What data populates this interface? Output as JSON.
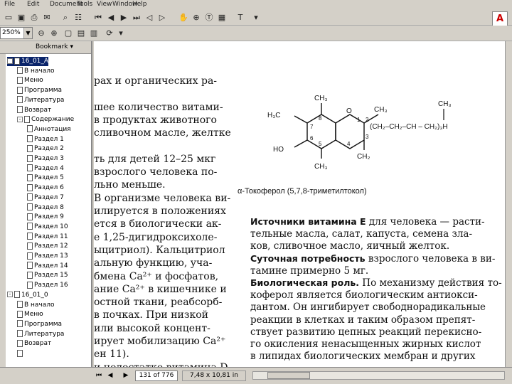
{
  "menu": {
    "items": [
      "File",
      "Edit",
      "Document",
      "Tools",
      "View",
      "Window",
      "Help"
    ]
  },
  "toolbar": {
    "zoom_value": "250%",
    "adobe_logo": "A"
  },
  "nav": {
    "bookmark_label": "Bookmark",
    "tree": [
      {
        "label": "16_01_A",
        "level": 0,
        "expander": "-",
        "selected": true
      },
      {
        "label": "В начало",
        "level": 1
      },
      {
        "label": "Меню",
        "level": 1
      },
      {
        "label": "Программа",
        "level": 1
      },
      {
        "label": "Литература",
        "level": 1
      },
      {
        "label": "Возврат",
        "level": 1
      },
      {
        "label": "Содержание",
        "level": 1,
        "expander": "-"
      },
      {
        "label": "Аннотация",
        "level": 2
      },
      {
        "label": "Раздел 1",
        "level": 2
      },
      {
        "label": "Раздел 2",
        "level": 2
      },
      {
        "label": "Раздел 3",
        "level": 2
      },
      {
        "label": "Раздел 4",
        "level": 2
      },
      {
        "label": "Раздел 5",
        "level": 2
      },
      {
        "label": "Раздел 6",
        "level": 2
      },
      {
        "label": "Раздел 7",
        "level": 2
      },
      {
        "label": "Раздел 8",
        "level": 2
      },
      {
        "label": "Раздел 9",
        "level": 2
      },
      {
        "label": "Раздел 10",
        "level": 2
      },
      {
        "label": "Раздел 11",
        "level": 2
      },
      {
        "label": "Раздел 12",
        "level": 2
      },
      {
        "label": "Раздел 13",
        "level": 2
      },
      {
        "label": "Раздел 14",
        "level": 2
      },
      {
        "label": "Раздел 15",
        "level": 2
      },
      {
        "label": "Раздел 16",
        "level": 2
      },
      {
        "label": "16_01_0",
        "level": 0,
        "expander": "-"
      },
      {
        "label": "В начало",
        "level": 1
      },
      {
        "label": "Меню",
        "level": 1
      },
      {
        "label": "Программа",
        "level": 1
      },
      {
        "label": "Литература",
        "level": 1
      },
      {
        "label": "Возврат",
        "level": 1
      },
      {
        "label": "",
        "level": 1
      }
    ]
  },
  "document": {
    "left_column": [
      "рах и органических ра-",
      "",
      "шее количество витами-",
      "в продуктах животного",
      "сливочном масле, желтке",
      "",
      "ть для детей 12–25 мкг",
      "взрослого человека по-",
      "льно меньше.",
      "В организме человека ви-",
      "илируется в положениях",
      "ется в биологически ак-",
      "е 1,25-дигидроксихоле-",
      "ыцитриол). Кальцитриол",
      "альную функцию, уча-",
      "бмена Ca²⁺ и фосфатов,",
      "ание Ca²⁺ в кишечнике и",
      "остной ткани, реабсорб-",
      "в почках. При низкой",
      "или высокой концент-",
      "ирует мобилизацию Ca²⁺",
      "ен 11).",
      "и недостатке витамина D"
    ],
    "chem": {
      "ch3_top": "CH₃",
      "h3c": "H₃C",
      "o_ring": "O",
      "ch3_right": "CH₃",
      "ch3_chain": "CH₃",
      "chain": "(CH₂–CH₂–CH – CH₂)₃H",
      "ho": "HO",
      "ch3_bottom": "CH₃",
      "ch2": "CH₂",
      "n8": "8",
      "n7": "7",
      "n6": "6",
      "n5": "5",
      "n1": "1",
      "n2": "2",
      "n3": "3",
      "n4": "4",
      "caption": "α-Токоферол (5,7,8-триметилтокол)"
    },
    "right_column": [
      {
        "bold": "Источники витамина Е",
        "text": " для человека — расти-"
      },
      {
        "bold": "",
        "text": "   тельные масла, салат, капуста, семена зла-"
      },
      {
        "bold": "",
        "text": "   ков, сливочное масло, яичный желток."
      },
      {
        "bold": "Суточная потребность",
        "text": " взрослого человека в ви-"
      },
      {
        "bold": "",
        "text": "   тамине примерно 5 мг."
      },
      {
        "bold": "Биологическая роль.",
        "text": " По механизму действия то-"
      },
      {
        "bold": "",
        "text": "   коферол является биологическим антиокси-"
      },
      {
        "bold": "",
        "text": "   дантом. Он ингибирует свободнорадикальные"
      },
      {
        "bold": "",
        "text": "   реакции в клетках и таким образом препят-"
      },
      {
        "bold": "",
        "text": "   ствует развитию цепных реакций перекисно-"
      },
      {
        "bold": "",
        "text": "   го окисления ненасыщенных жирных кислот"
      },
      {
        "bold": "",
        "text": "   в липидах биологических мембран и других"
      }
    ]
  },
  "status": {
    "page": "131 of 776",
    "size": "7,48 x 10,81 in"
  }
}
